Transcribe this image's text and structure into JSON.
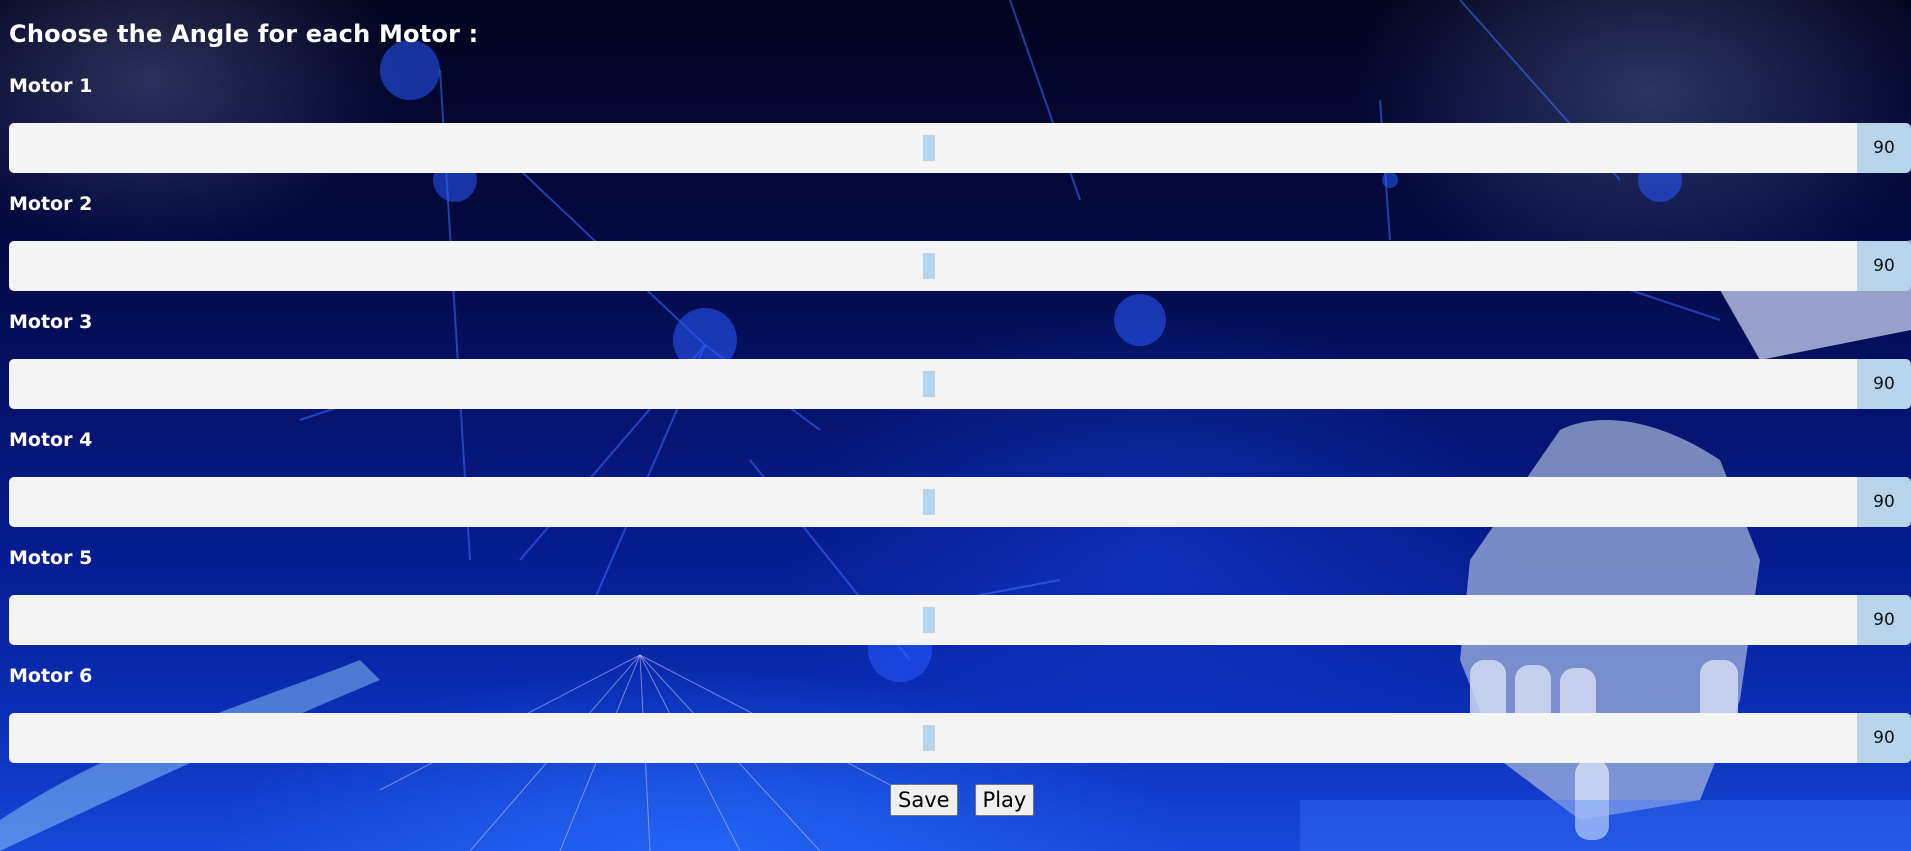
{
  "page": {
    "title": "Choose the Angle for each Motor :"
  },
  "motors": [
    {
      "label": "Motor 1",
      "value": "90",
      "angle": 90,
      "max": 180
    },
    {
      "label": "Motor 2",
      "value": "90",
      "angle": 90,
      "max": 180
    },
    {
      "label": "Motor 3",
      "value": "90",
      "angle": 90,
      "max": 180
    },
    {
      "label": "Motor 4",
      "value": "90",
      "angle": 90,
      "max": 180
    },
    {
      "label": "Motor 5",
      "value": "90",
      "angle": 90,
      "max": 180
    },
    {
      "label": "Motor 6",
      "value": "90",
      "angle": 90,
      "max": 180
    }
  ],
  "actions": {
    "save_label": "Save",
    "play_label": "Play"
  },
  "colors": {
    "track": "#f4f4f4",
    "thumb": "#b8d4ea",
    "value_box": "#b8d4ea",
    "background_primary": "#061a8a"
  }
}
